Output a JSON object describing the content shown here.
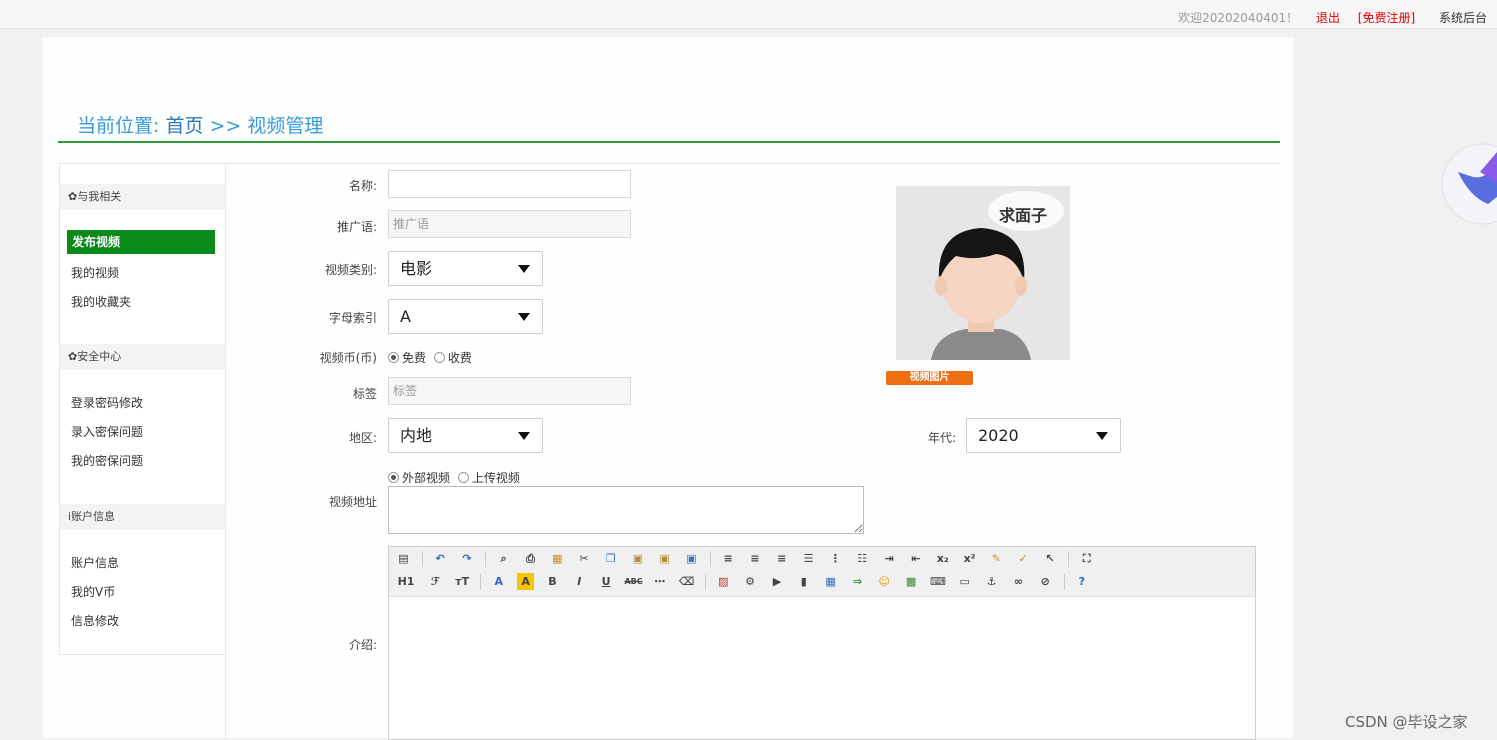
{
  "topbar": {
    "welcome": "欢迎20202040401！",
    "logout": "退出",
    "register": "[免费注册]",
    "admin": "系统后台"
  },
  "breadcrumb": {
    "prefix": "当前位置:",
    "home": "首页",
    "sep": ">>",
    "current": "视频管理"
  },
  "sidebar": {
    "sections": [
      {
        "title": "与我相关",
        "items": [
          "发布视频",
          "我的视频",
          "我的收藏夹"
        ]
      },
      {
        "title": "安全中心",
        "items": [
          "登录密码修改",
          "录入密保问题",
          "我的密保问题"
        ]
      },
      {
        "title": "账户信息",
        "items": [
          "账户信息",
          "我的V币",
          "信息修改"
        ]
      }
    ]
  },
  "form": {
    "name_label": "名称:",
    "name_value": "",
    "slogan_label": "推广语:",
    "slogan_placeholder": "推广语",
    "category_label": "视频类别:",
    "category_value": "电影",
    "letter_label": "字母索引",
    "letter_value": "A",
    "coin_label": "视频币(币)",
    "coin_options": [
      "免费",
      "收费"
    ],
    "tag_label": "标签",
    "tag_placeholder": "标签",
    "region_label": "地区:",
    "region_value": "内地",
    "year_label": "年代:",
    "year_value": "2020",
    "url_label": "视频地址",
    "url_options": [
      "外部视频",
      "上传视频"
    ],
    "intro_label": "介绍:",
    "image_button": "视频图片",
    "avatar_caption": "求面子"
  },
  "toolbar": {
    "row1": [
      "source",
      "undo",
      "redo",
      "preview",
      "print",
      "template",
      "cut",
      "copy",
      "paste",
      "paste-text",
      "paste-word",
      "align-left",
      "align-center",
      "align-right",
      "justify",
      "ordered-list",
      "unordered-list",
      "indent",
      "outdent",
      "subscript",
      "superscript",
      "clear-format",
      "spellcheck",
      "select-all",
      "fullscreen"
    ],
    "row2": [
      "H1",
      "F",
      "T",
      "A",
      "A",
      "B",
      "I",
      "U",
      "ABC",
      "hr",
      "eraser",
      "image",
      "flash",
      "media",
      "table-cell",
      "table",
      "insert-row",
      "emoticon",
      "photo",
      "code",
      "pagebreak",
      "anchor",
      "link",
      "unlink",
      "help"
    ],
    "labels": {
      "h1": "H1",
      "bold": "B",
      "italic": "I",
      "underline": "U",
      "strike": "ABC"
    }
  },
  "watermark": "CSDN @毕设之家",
  "colors": {
    "accent_green": "#0b8a1c",
    "breadcrumb_blue": "#3a9ad9",
    "button_orange": "#f06e10",
    "topbar_red": "#e10000"
  }
}
